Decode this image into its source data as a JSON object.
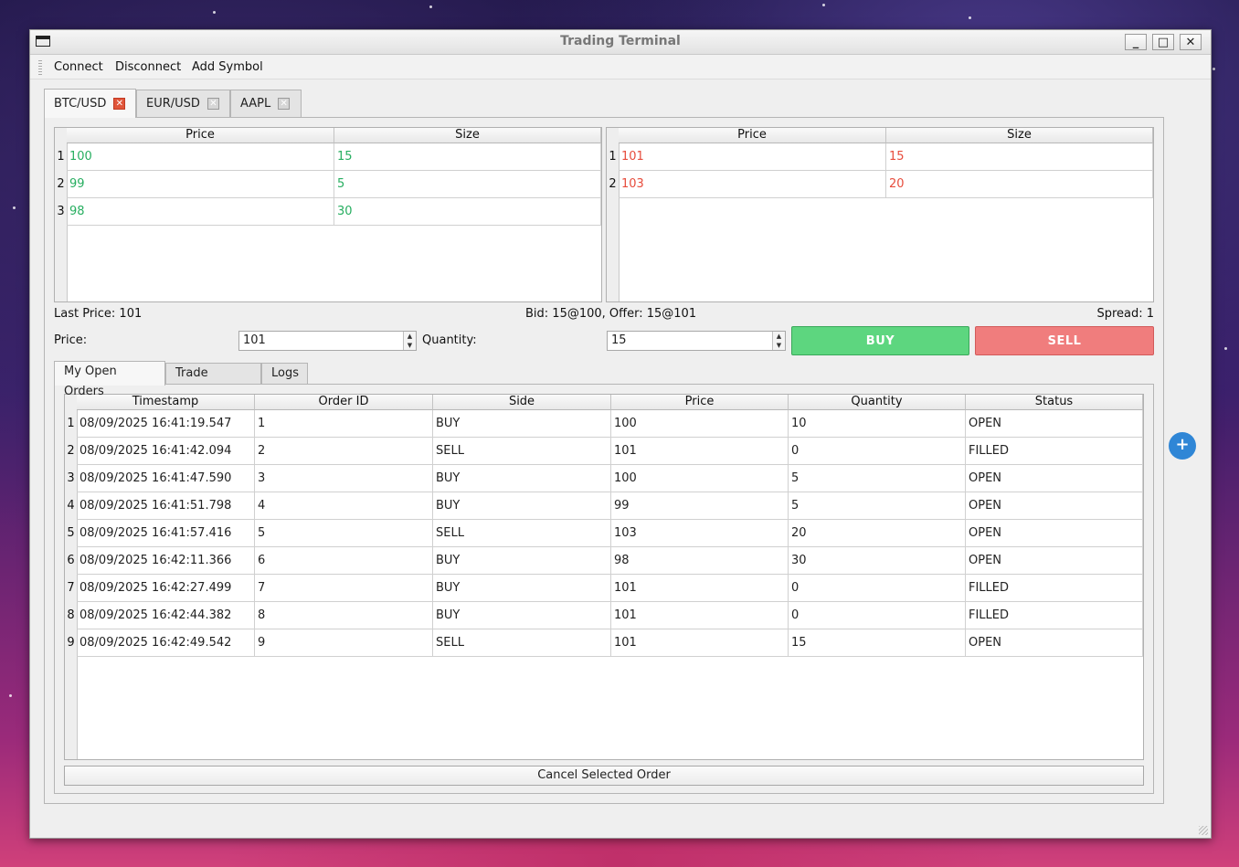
{
  "window": {
    "title": "Trading Terminal"
  },
  "menu": [
    "Connect",
    "Disconnect",
    "Add Symbol"
  ],
  "symbol_tabs": [
    "BTC/USD",
    "EUR/USD",
    "AAPL"
  ],
  "order_book": {
    "headers": [
      "Price",
      "Size"
    ],
    "bids": [
      [
        "100",
        "15"
      ],
      [
        "99",
        "5"
      ],
      [
        "98",
        "30"
      ]
    ],
    "asks": [
      [
        "101",
        "15"
      ],
      [
        "103",
        "20"
      ]
    ],
    "bid_color": "#27ae60",
    "ask_color": "#e74c3c"
  },
  "market": {
    "last_price": "Last Price: 101",
    "bid_offer": "Bid: 15@100, Offer: 15@101",
    "spread": "Spread: 1"
  },
  "order_entry": {
    "price_label": "Price:",
    "price_value": "101",
    "quantity_label": "Quantity:",
    "quantity_value": "15",
    "buy_label": "BUY",
    "sell_label": "SELL",
    "buy_color": "#5dd67f",
    "sell_color": "#f07d7d"
  },
  "bottom_tabs": [
    "My Open Orders",
    "Trade History",
    "Logs"
  ],
  "orders": {
    "headers": [
      "Timestamp",
      "Order ID",
      "Side",
      "Price",
      "Quantity",
      "Status"
    ],
    "rows": [
      [
        "08/09/2025 16:41:19.547",
        "1",
        "BUY",
        "100",
        "10",
        "OPEN"
      ],
      [
        "08/09/2025 16:41:42.094",
        "2",
        "SELL",
        "101",
        "0",
        "FILLED"
      ],
      [
        "08/09/2025 16:41:47.590",
        "3",
        "BUY",
        "100",
        "5",
        "OPEN"
      ],
      [
        "08/09/2025 16:41:51.798",
        "4",
        "BUY",
        "99",
        "5",
        "OPEN"
      ],
      [
        "08/09/2025 16:41:57.416",
        "5",
        "SELL",
        "103",
        "20",
        "OPEN"
      ],
      [
        "08/09/2025 16:42:11.366",
        "6",
        "BUY",
        "98",
        "30",
        "OPEN"
      ],
      [
        "08/09/2025 16:42:27.499",
        "7",
        "BUY",
        "101",
        "0",
        "FILLED"
      ],
      [
        "08/09/2025 16:42:44.382",
        "8",
        "BUY",
        "101",
        "0",
        "FILLED"
      ],
      [
        "08/09/2025 16:42:49.542",
        "9",
        "SELL",
        "101",
        "15",
        "OPEN"
      ]
    ]
  },
  "cancel_button": "Cancel Selected Order",
  "fab_label": "+"
}
